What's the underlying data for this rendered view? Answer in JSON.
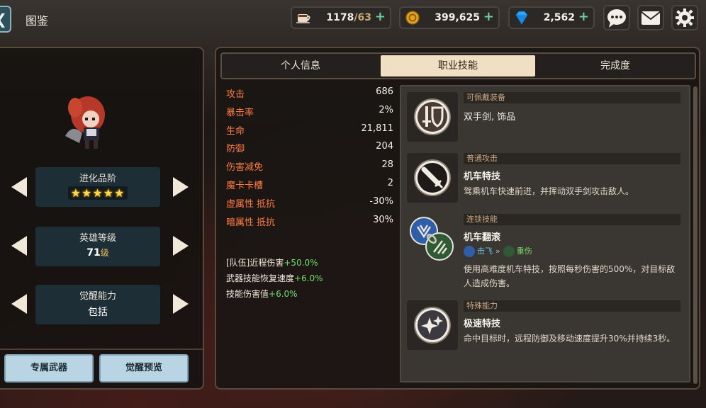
{
  "header": {
    "title": "图鉴",
    "stamina": {
      "value": "1178",
      "cap": "/63"
    },
    "gold": "399,625",
    "gems": "2,562"
  },
  "left": {
    "evolution": {
      "label": "进化品阶",
      "stars": "★★★★★"
    },
    "level": {
      "label": "英雄等级",
      "value": "71",
      "unit": "级"
    },
    "awaken": {
      "label": "觉醒能力",
      "value": "包括"
    },
    "buttons": {
      "weapon": "专属武器",
      "preview": "觉醒预览"
    }
  },
  "tabs": [
    "个人信息",
    "职业技能",
    "完成度"
  ],
  "stats": [
    {
      "k": "攻击",
      "v": "686"
    },
    {
      "k": "暴击率",
      "v": "2%"
    },
    {
      "k": "生命",
      "v": "21,811"
    },
    {
      "k": "防御",
      "v": "204"
    },
    {
      "k": "伤害减免",
      "v": "28"
    },
    {
      "k": "魔卡卡槽",
      "v": "2"
    },
    {
      "k": "虚属性",
      "sub": "抵抗",
      "v": "-30%"
    },
    {
      "k": "暗属性",
      "sub": "抵抗",
      "v": "30%"
    }
  ],
  "bonuses": [
    {
      "text": "[队伍]近程伤害",
      "pct": "+50.0%"
    },
    {
      "text": "武器技能恢复速度",
      "pct": "+6.0%"
    },
    {
      "text": "技能伤害值",
      "pct": "+6.0%"
    }
  ],
  "skills": {
    "equip": {
      "category": "可佩戴装备",
      "desc": "双手剑, 饰品"
    },
    "normal": {
      "category": "普通攻击",
      "name": "机车特技",
      "desc": "驾乘机车快速前进，并挥动双手剑攻击敌人。"
    },
    "chain": {
      "category": "连锁技能",
      "name": "机车翻滚",
      "tag1": "击飞",
      "sep": "»",
      "tag2": "重伤",
      "desc": "使用高难度机车特技，按照每秒伤害的500%，对目标敌人造成伤害。"
    },
    "special": {
      "category": "特殊能力",
      "name": "极速特技",
      "desc": "命中目标时，远程防御及移动速度提升30%并持续3秒。"
    }
  },
  "colors": {
    "stat_label": "#ff7a45",
    "bonus_green": "#6ee06a",
    "active_tab": "#f1dfc3",
    "button_blue": "#b9d5e4"
  }
}
